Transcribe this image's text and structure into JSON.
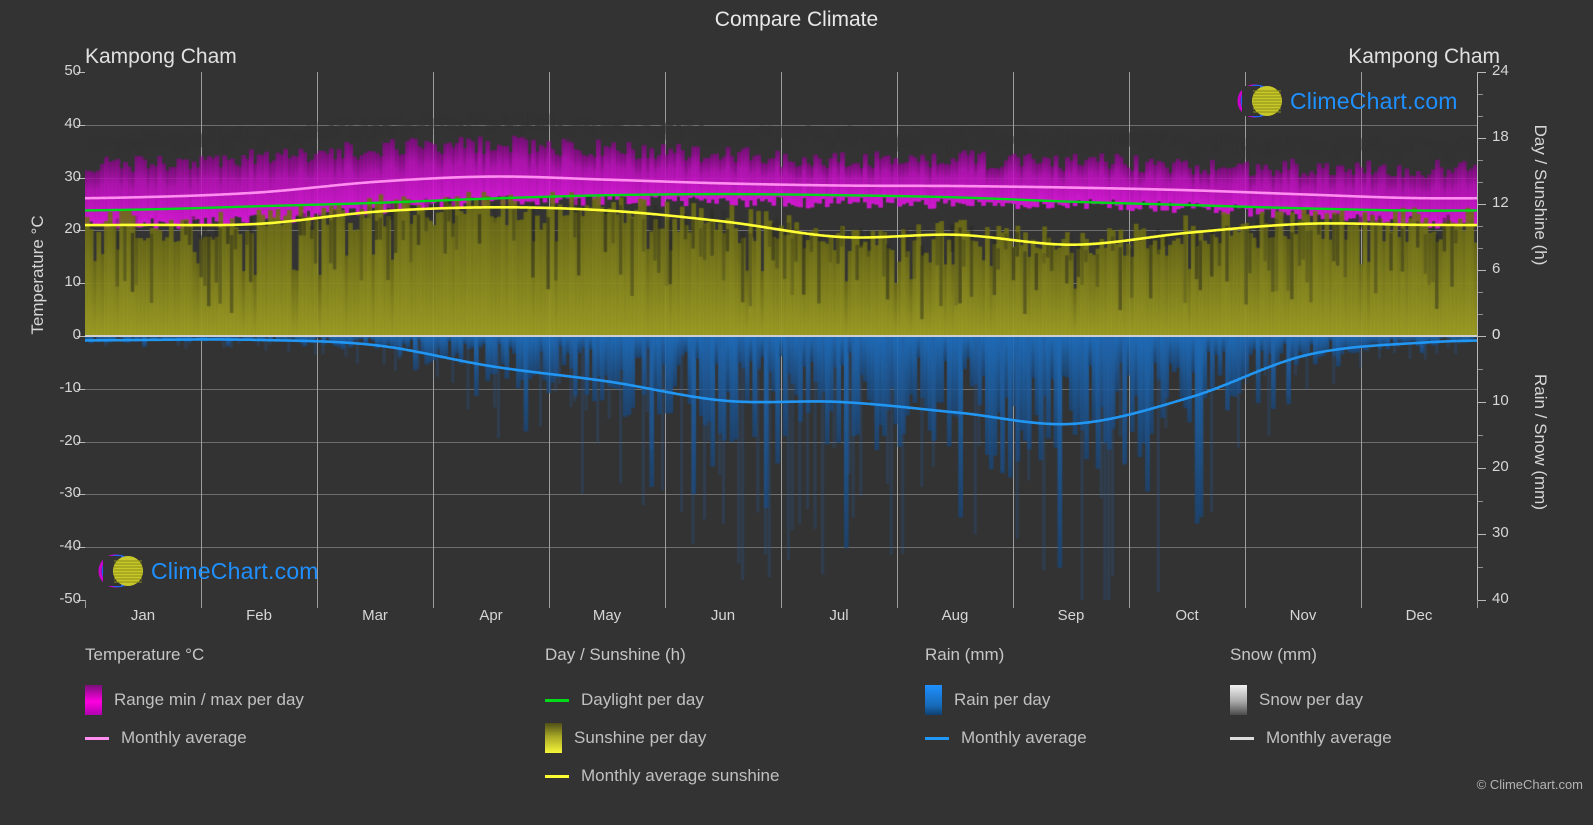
{
  "header": {
    "title": "Compare Climate",
    "location_left": "Kampong Cham",
    "location_right": "Kampong Cham"
  },
  "axes": {
    "left_title": "Temperature °C",
    "right_top_title": "Day / Sunshine (h)",
    "right_bottom_title": "Rain / Snow (mm)",
    "temp_ticks": [
      "50",
      "40",
      "30",
      "20",
      "10",
      "0",
      "-10",
      "-20",
      "-30",
      "-40",
      "-50"
    ],
    "day_ticks": [
      "24",
      "18",
      "12",
      "6",
      "0"
    ],
    "rain_ticks": [
      "0",
      "10",
      "20",
      "30",
      "40"
    ],
    "months": [
      "Jan",
      "Feb",
      "Mar",
      "Apr",
      "May",
      "Jun",
      "Jul",
      "Aug",
      "Sep",
      "Oct",
      "Nov",
      "Dec"
    ]
  },
  "legend": {
    "temperature": {
      "heading": "Temperature °C",
      "range_label": "Range min / max per day",
      "average_label": "Monthly average",
      "range_color": "#ff00e0",
      "average_color": "#ff8ef0"
    },
    "day_sunshine": {
      "heading": "Day / Sunshine (h)",
      "daylight_label": "Daylight per day",
      "sunshine_label": "Sunshine per day",
      "avg_sunshine_label": "Monthly average sunshine",
      "daylight_color": "#00d919",
      "sunshine_color": "#f5f53a",
      "avg_sunshine_color": "#ffff33"
    },
    "rain": {
      "heading": "Rain (mm)",
      "per_day_label": "Rain per day",
      "average_label": "Monthly average",
      "bar_color": "#1e90ff",
      "average_color": "#2196f3"
    },
    "snow": {
      "heading": "Snow (mm)",
      "per_day_label": "Snow per day",
      "average_label": "Monthly average",
      "bar_color": "#e8e8e8",
      "average_color": "#dddddd"
    }
  },
  "watermark": {
    "brand": "ClimeChart.com",
    "copyright": "© ClimeChart.com"
  },
  "chart_data": {
    "type": "area",
    "title": "Compare Climate",
    "subtitle": "Kampong Cham",
    "xlabel": "",
    "ylabel": "Temperature °C",
    "categories": [
      "Jan",
      "Feb",
      "Mar",
      "Apr",
      "May",
      "Jun",
      "Jul",
      "Aug",
      "Sep",
      "Oct",
      "Nov",
      "Dec"
    ],
    "temp_ylim": [
      -50,
      50
    ],
    "day_ylim": [
      0,
      24
    ],
    "rain_ylim": [
      0,
      40
    ],
    "grid": true,
    "legend_position": "below",
    "series": [
      {
        "name": "Monthly average temperature",
        "unit": "°C",
        "color": "#ff8ef0",
        "values": [
          26.3,
          27.2,
          29.2,
          30.2,
          29.6,
          28.9,
          28.5,
          28.4,
          28.1,
          27.6,
          26.8,
          26.1
        ]
      },
      {
        "name": "Range max per day",
        "unit": "°C",
        "color": "#ff00e0",
        "values": [
          32.5,
          33.6,
          35.2,
          36.1,
          35.2,
          34.0,
          33.4,
          33.2,
          32.8,
          32.2,
          31.7,
          31.4
        ]
      },
      {
        "name": "Range min per day",
        "unit": "°C",
        "color": "#ff00e0",
        "values": [
          21.2,
          22.0,
          24.0,
          25.5,
          25.6,
          25.4,
          25.2,
          25.1,
          24.9,
          24.3,
          23.0,
          21.5
        ]
      },
      {
        "name": "Daylight per day",
        "unit": "h",
        "color": "#00d919",
        "values": [
          11.5,
          11.8,
          12.1,
          12.5,
          12.8,
          12.9,
          12.8,
          12.6,
          12.2,
          11.9,
          11.6,
          11.4
        ]
      },
      {
        "name": "Monthly average sunshine",
        "unit": "h",
        "color": "#ffff33",
        "values": [
          10.1,
          10.2,
          11.3,
          11.7,
          11.4,
          10.4,
          9.0,
          9.2,
          8.3,
          9.4,
          10.2,
          10.1
        ]
      },
      {
        "name": "Monthly average rain",
        "unit": "mm",
        "color": "#2196f3",
        "values": [
          0.6,
          0.6,
          1.4,
          4.6,
          6.9,
          9.8,
          10.0,
          11.6,
          13.3,
          9.3,
          2.9,
          1.0
        ]
      },
      {
        "name": "Monthly average snow",
        "unit": "mm",
        "color": "#dddddd",
        "values": [
          0,
          0,
          0,
          0,
          0,
          0,
          0,
          0,
          0,
          0,
          0,
          0
        ]
      }
    ]
  }
}
